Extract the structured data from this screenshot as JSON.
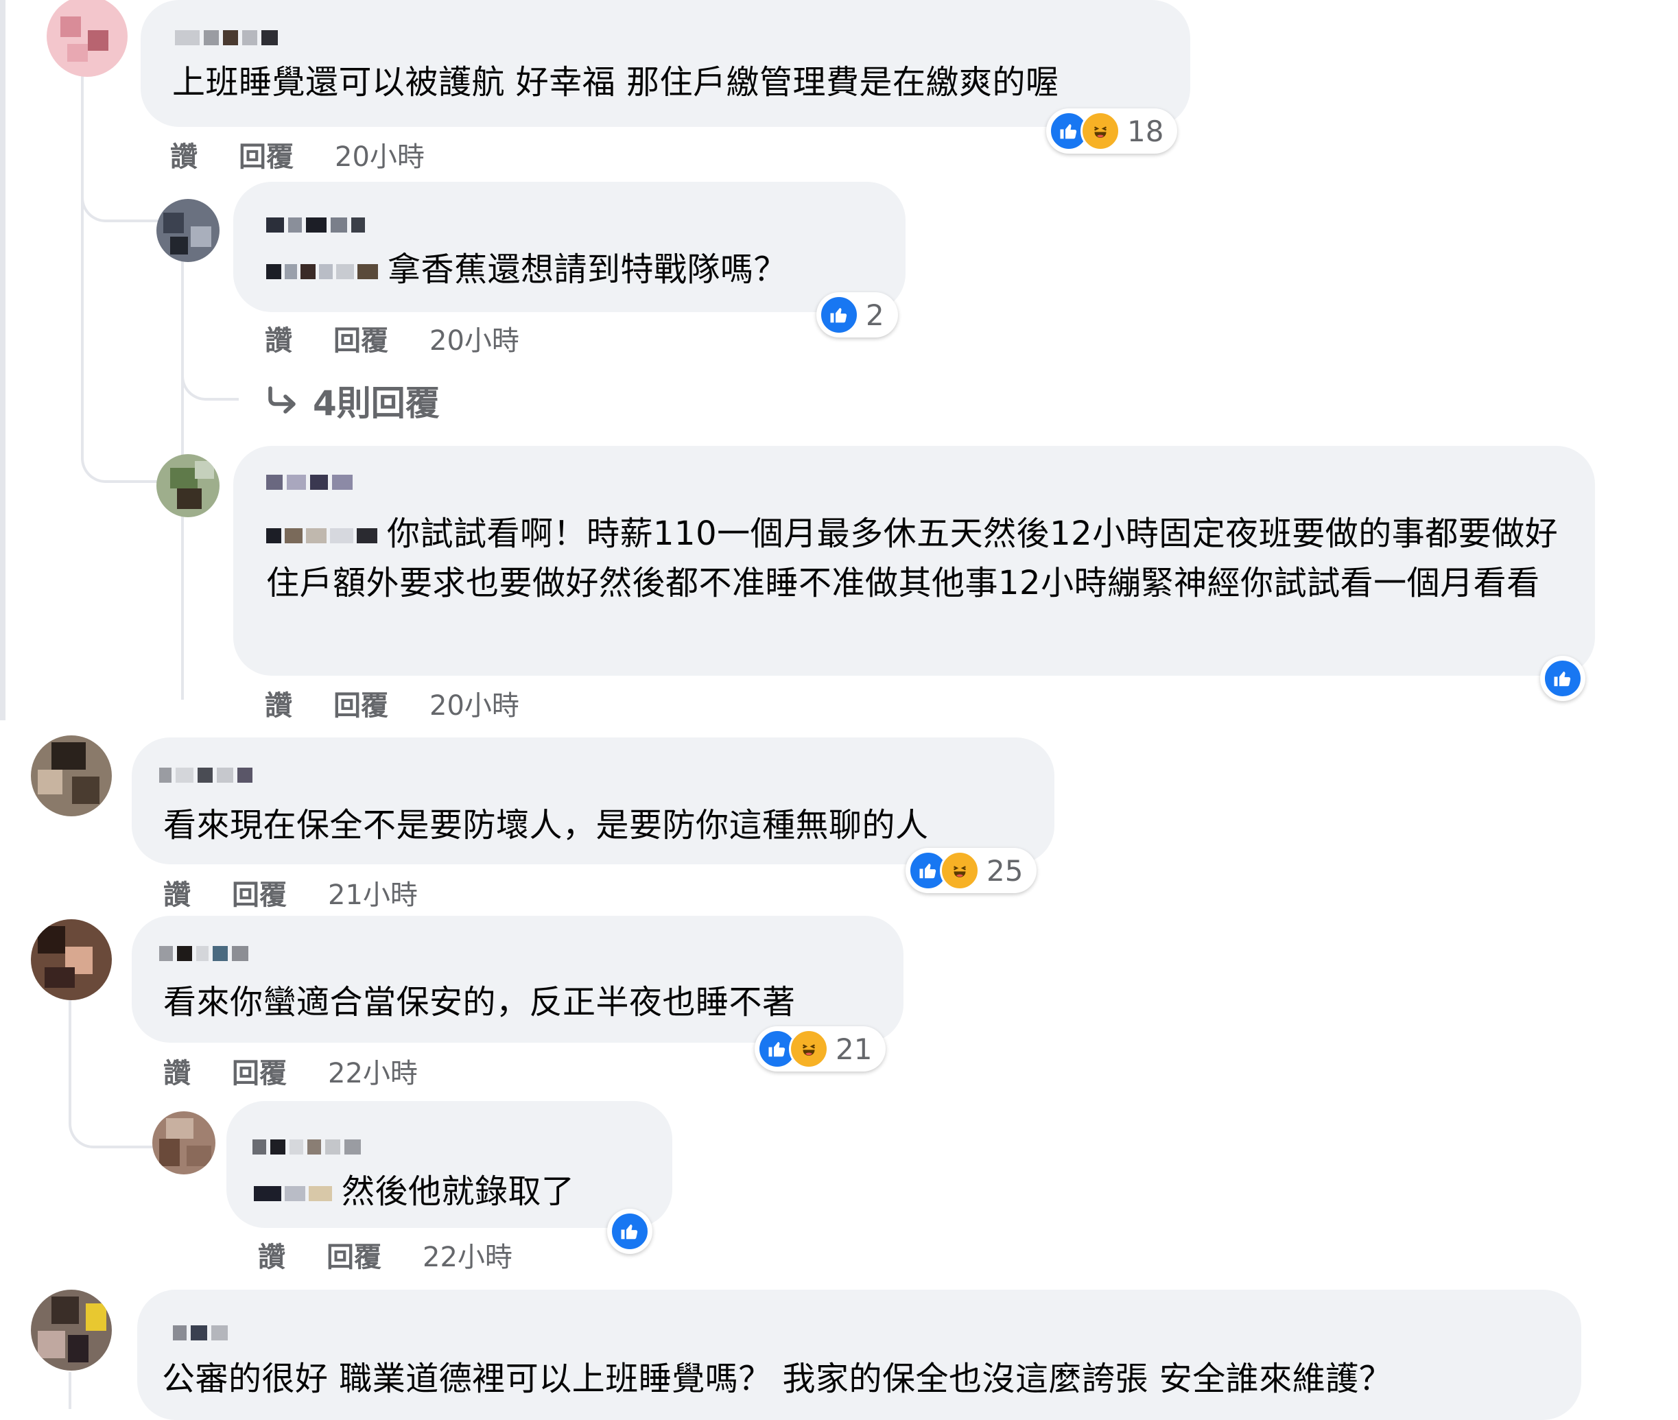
{
  "comments": [
    {
      "text": "上班睡覺還可以被護航 好幸福 那住戶繳管理費是在繳爽的喔",
      "actions": {
        "like": "讚",
        "reply": "回覆",
        "time": "20小時"
      },
      "reactions": {
        "icons": [
          "like-icon",
          "haha-icon"
        ],
        "count": "18"
      }
    },
    {
      "text": "拿香蕉還想請到特戰隊嗎？",
      "actions": {
        "like": "讚",
        "reply": "回覆",
        "time": "20小時"
      },
      "reactions": {
        "icons": [
          "like-icon"
        ],
        "count": "2"
      },
      "replies_link": "4則回覆"
    },
    {
      "text": "你試試看啊！時薪110一個月最多休五天然後12小時固定夜班要做的事都要做好住戶額外要求也要做好然後都不准睡不准做其他事12小時繃緊神經你試試看一個月看看",
      "actions": {
        "like": "讚",
        "reply": "回覆",
        "time": "20小時"
      },
      "reactions": {
        "icons": [
          "like-icon"
        ],
        "count": ""
      }
    },
    {
      "text": "看來現在保全不是要防壞人，是要防你這種無聊的人",
      "actions": {
        "like": "讚",
        "reply": "回覆",
        "time": "21小時"
      },
      "reactions": {
        "icons": [
          "like-icon",
          "haha-icon"
        ],
        "count": "25"
      }
    },
    {
      "text": "看來你蠻適合當保安的，反正半夜也睡不著",
      "actions": {
        "like": "讚",
        "reply": "回覆",
        "time": "22小時"
      },
      "reactions": {
        "icons": [
          "like-icon",
          "haha-icon"
        ],
        "count": "21"
      }
    },
    {
      "text": "然後他就錄取了",
      "actions": {
        "like": "讚",
        "reply": "回覆",
        "time": "22小時"
      },
      "reactions": {
        "icons": [
          "like-icon"
        ],
        "count": ""
      }
    },
    {
      "text": "公審的很好 職業道德裡可以上班睡覺嗎？ 我家的保全也沒這麼誇張 安全誰來維護？"
    }
  ],
  "colors": {
    "bubble": "#f0f2f5",
    "secondary_text": "#65676b",
    "like": "#1877f2",
    "haha": "#f7b125"
  }
}
